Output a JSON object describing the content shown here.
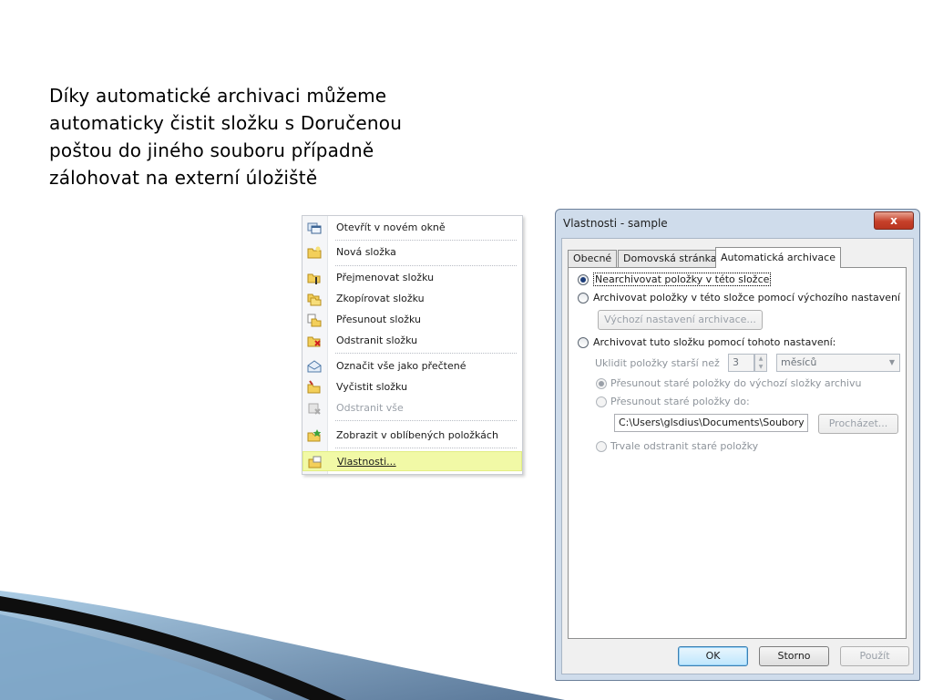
{
  "slide": {
    "lines": [
      "Díky automatické archivaci můžeme",
      "automaticky čistit složku s Doručenou",
      "poštou do jiného souboru případně",
      "zálohovat na externí úložiště"
    ]
  },
  "context_menu": {
    "items": [
      {
        "label": "Otevřít v novém okně",
        "icon": "new-window-icon",
        "disabled": false
      },
      {
        "label": "Nová složka",
        "icon": "new-folder-icon",
        "disabled": false
      },
      {
        "label": "Přejmenovat složku",
        "icon": "rename-folder-icon",
        "disabled": false
      },
      {
        "label": "Zkopírovat složku",
        "icon": "copy-folder-icon",
        "disabled": false
      },
      {
        "label": "Přesunout složku",
        "icon": "move-folder-icon",
        "disabled": false
      },
      {
        "label": "Odstranit složku",
        "icon": "delete-folder-icon",
        "disabled": false
      },
      {
        "label": "Označit vše jako přečtené",
        "icon": "mark-read-icon",
        "disabled": false
      },
      {
        "label": "Vyčistit složku",
        "icon": "clean-folder-icon",
        "disabled": false
      },
      {
        "label": "Odstranit vše",
        "icon": "delete-all-icon",
        "disabled": true
      },
      {
        "label": "Zobrazit v oblíbených položkách",
        "icon": "favorites-icon",
        "disabled": false
      },
      {
        "label": "Vlastnosti...",
        "icon": "properties-icon",
        "disabled": false,
        "highlighted": true
      }
    ]
  },
  "dialog": {
    "title": "Vlastnosti - sample",
    "close_label": "x",
    "tabs": [
      "Obecné",
      "Domovská stránka",
      "Automatická archivace"
    ],
    "active_tab": "Automatická archivace",
    "options": {
      "no_archive": "Nearchivovat položky v této složce",
      "default_archive": "Archivovat položky v této složce pomocí výchozího nastavení",
      "default_settings_button": "Výchozí nastavení archivace...",
      "custom_archive": "Archivovat tuto složku pomocí tohoto nastavení:",
      "clean_older_label": "Uklidit položky starší než",
      "age_value": "3",
      "age_unit": "měsíců",
      "move_default": "Přesunout staré položky do výchozí složky archivu",
      "move_to": "Přesunout staré položky do:",
      "path_value": "C:\\Users\\glsdius\\Documents\\Soubory ap",
      "browse_button": "Procházet...",
      "delete_permanently": "Trvale odstranit staré položky"
    },
    "buttons": {
      "ok": "OK",
      "cancel": "Storno",
      "apply": "Použít"
    }
  },
  "colors": {
    "highlight": "#f1f9a6",
    "dialog_frame": "#cfdceb",
    "close_button": "#c6402a"
  }
}
